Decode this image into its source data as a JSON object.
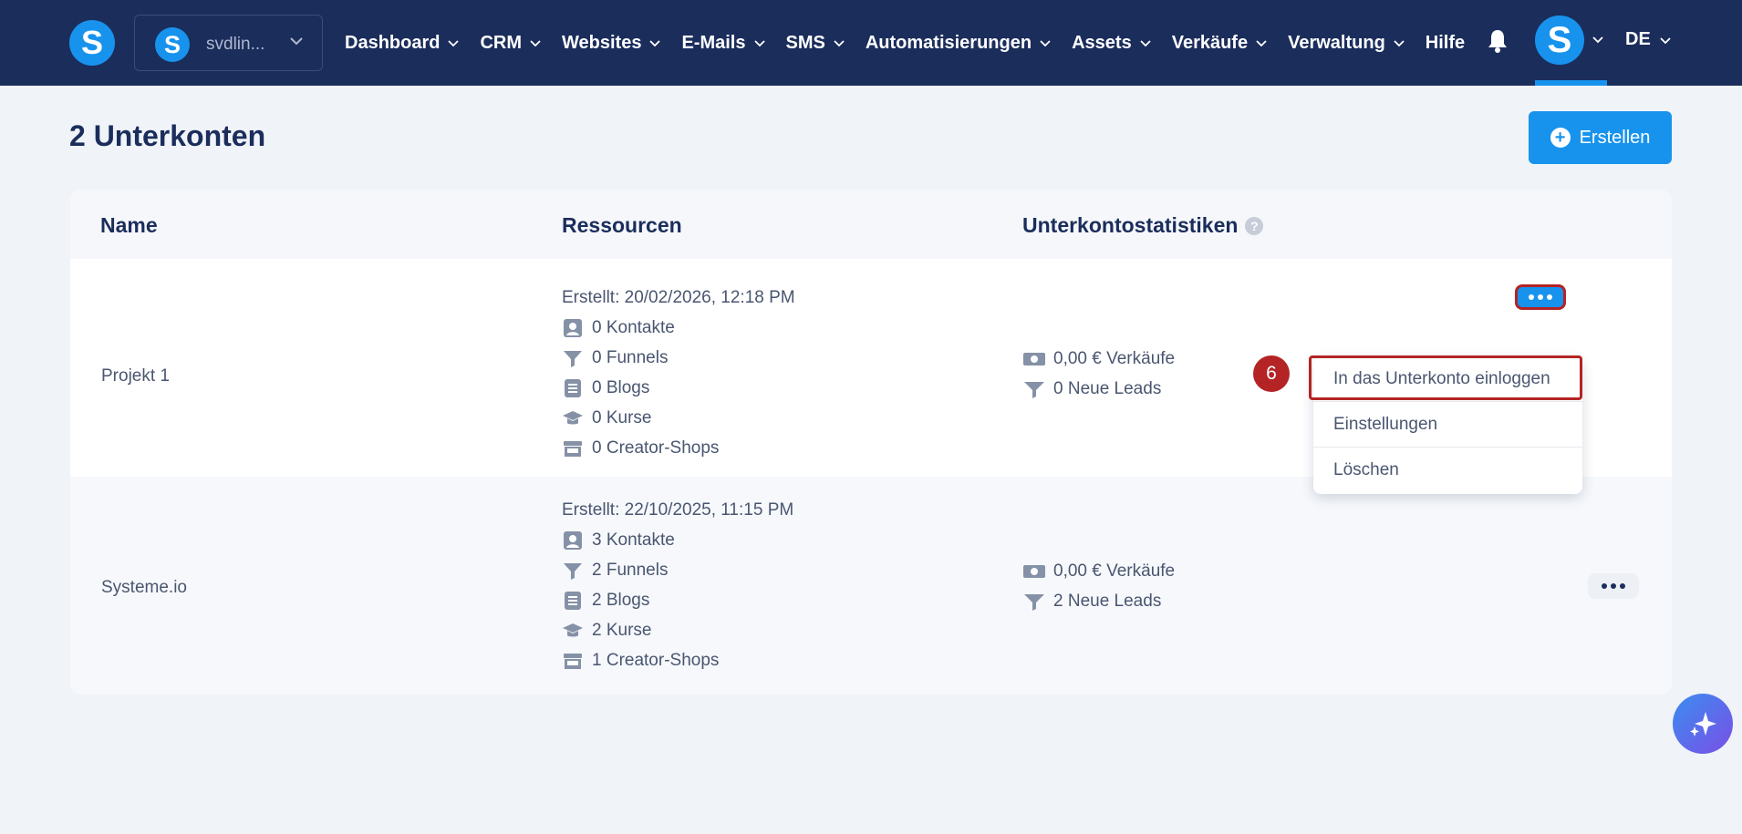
{
  "topbar": {
    "logo_letter": "S",
    "account": {
      "avatar_letter": "S",
      "name": "svdlin..."
    },
    "nav": [
      {
        "label": "Dashboard",
        "has_chevron": true
      },
      {
        "label": "CRM",
        "has_chevron": true
      },
      {
        "label": "Websites",
        "has_chevron": true
      },
      {
        "label": "E-Mails",
        "has_chevron": true
      },
      {
        "label": "SMS",
        "has_chevron": true
      },
      {
        "label": "Automatisierungen",
        "has_chevron": true
      },
      {
        "label": "Assets",
        "has_chevron": true
      },
      {
        "label": "Verkäufe",
        "has_chevron": true
      },
      {
        "label": "Verwaltung",
        "has_chevron": true
      },
      {
        "label": "Hilfe",
        "has_chevron": false
      }
    ],
    "user_avatar_letter": "S",
    "language": "DE"
  },
  "page": {
    "title": "2 Unterkonten",
    "create_label": "Erstellen"
  },
  "table": {
    "headers": {
      "name": "Name",
      "resources": "Ressourcen",
      "stats": "Unterkontostatistiken"
    },
    "rows": [
      {
        "name": "Projekt 1",
        "created": "Erstellt: 20/02/2026, 12:18 PM",
        "contacts": "0 Kontakte",
        "funnels": "0 Funnels",
        "blogs": "0 Blogs",
        "courses": "0 Kurse",
        "shops": "0 Creator-Shops",
        "sales": "0,00 € Verkäufe",
        "leads": "0 Neue Leads"
      },
      {
        "name": "Systeme.io",
        "created": "Erstellt: 22/10/2025, 11:15 PM",
        "contacts": "3 Kontakte",
        "funnels": "2 Funnels",
        "blogs": "2 Blogs",
        "courses": "2 Kurse",
        "shops": "1 Creator-Shops",
        "sales": "0,00 € Verkäufe",
        "leads": "2 Neue Leads"
      }
    ]
  },
  "dropdown": {
    "items": [
      "In das Unterkonto einloggen",
      "Einstellungen",
      "Löschen"
    ]
  },
  "step_badge": "6",
  "colors": {
    "topbar": "#1b2d5b",
    "accent": "#1793ee",
    "highlight": "#b42424",
    "background": "#f0f3f8"
  }
}
